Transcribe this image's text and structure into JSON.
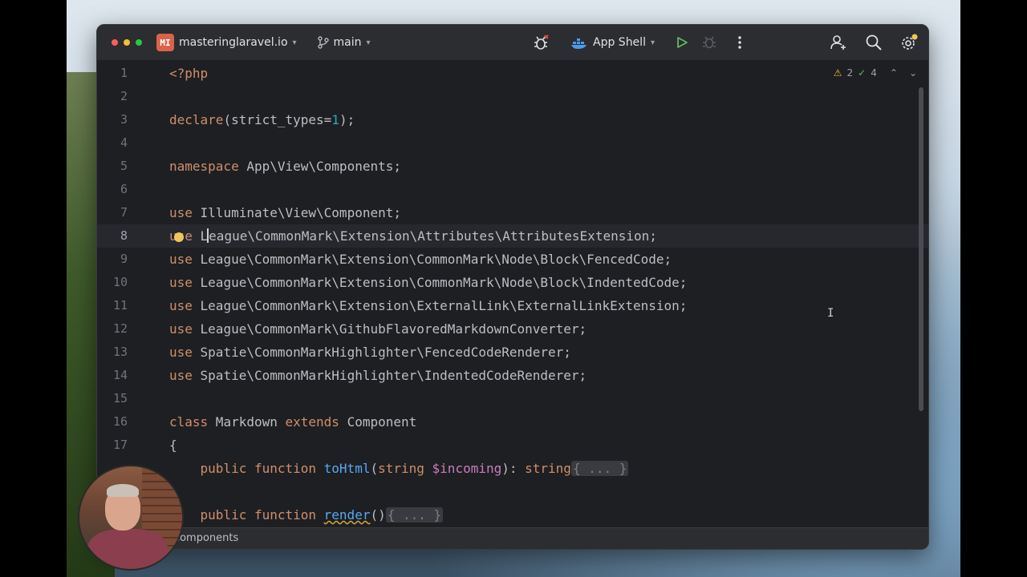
{
  "titlebar": {
    "project_badge": "MI",
    "project_name": "masteringlaravel.io",
    "branch": "main",
    "run_config": "App Shell"
  },
  "inspections": {
    "warnings": "2",
    "ok": "4"
  },
  "editor": {
    "current_line": 8,
    "lines": [
      {
        "n": "1"
      },
      {
        "n": "2"
      },
      {
        "n": "3"
      },
      {
        "n": "4"
      },
      {
        "n": "5"
      },
      {
        "n": "6"
      },
      {
        "n": "7"
      },
      {
        "n": "8"
      },
      {
        "n": "9"
      },
      {
        "n": "10"
      },
      {
        "n": "11"
      },
      {
        "n": "12"
      },
      {
        "n": "13"
      },
      {
        "n": "14"
      },
      {
        "n": "15"
      },
      {
        "n": "16"
      },
      {
        "n": "17"
      }
    ],
    "code": {
      "l1": "<?php",
      "l3_kw": "declare",
      "l3_a": "(strict_types=",
      "l3_num": "1",
      "l3_b": ");",
      "l5_kw": "namespace",
      "l5_rest": " App\\View\\Components;",
      "use_kw": "use",
      "l7_rest": " Illuminate\\View\\Component;",
      "l8_a": " L",
      "l8_b": "eague\\CommonMark\\Extension\\Attributes\\AttributesExtension;",
      "l9_rest": " League\\CommonMark\\Extension\\CommonMark\\Node\\Block\\FencedCode;",
      "l10_rest": " League\\CommonMark\\Extension\\CommonMark\\Node\\Block\\IndentedCode;",
      "l11_rest": " League\\CommonMark\\Extension\\ExternalLink\\ExternalLinkExtension;",
      "l12_rest": " League\\CommonMark\\GithubFlavoredMarkdownConverter;",
      "l13_rest": " Spatie\\CommonMarkHighlighter\\FencedCodeRenderer;",
      "l14_rest": " Spatie\\CommonMarkHighlighter\\IndentedCodeRenderer;",
      "l16_class": "class",
      "l16_name": " Markdown ",
      "l16_extends": "extends",
      "l16_parent": " Component",
      "l17": "{",
      "m1_public": "    public",
      "m1_function": " function ",
      "m1_name": "toHtml",
      "m1_open": "(",
      "m1_type": "string",
      "m1_sp": " ",
      "m1_var": "$incoming",
      "m1_close": "): ",
      "m1_ret": "string",
      "fold": "{ ... }",
      "m2_public": "    public",
      "m2_function": " function ",
      "m2_name": "render",
      "m2_paren": "()"
    }
  },
  "statusbar": {
    "breadcrumb": "Components"
  }
}
